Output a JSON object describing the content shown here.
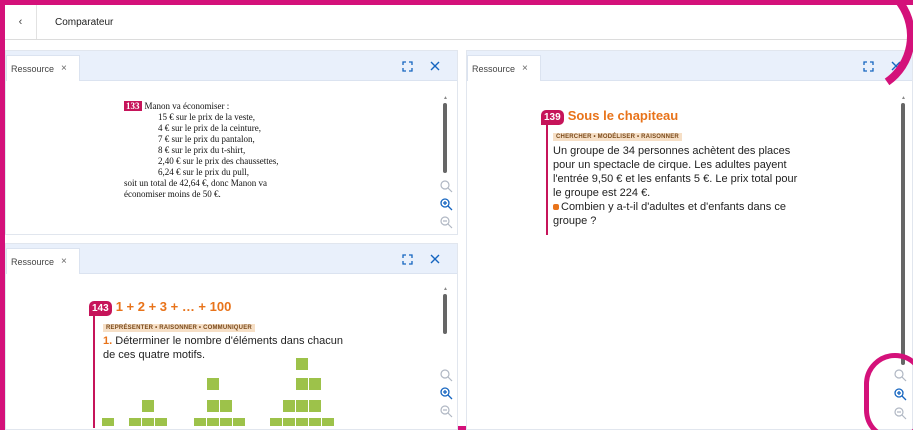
{
  "app": {
    "back_icon": "chevron-left-icon",
    "title": "Comparateur"
  },
  "panels": [
    {
      "tab_label": "Ressource",
      "close_tab_symbol": "×",
      "exercise": {
        "number": "133",
        "intro": "Manon va économiser :",
        "lines": [
          "15 € sur le prix de la veste,",
          "4 € sur le prix de la ceinture,",
          "7 € sur le prix du pantalon,",
          "8 € sur le prix du t-shirt,",
          "2,40 € sur le prix des chaussettes,",
          "6,24 € sur le prix du pull,"
        ],
        "conclusion_1": "soit un total de 42,64 €, donc Manon va",
        "conclusion_2": "économiser moins de 50 €."
      }
    },
    {
      "tab_label": "Ressource",
      "close_tab_symbol": "×",
      "exercise": {
        "number": "143",
        "title": "1 + 2 + 3 + … + 100",
        "skills": "REPRÉSENTER • RAISONNER • COMMUNIQUER",
        "q_num": "1.",
        "q_line_1": "Déterminer le nombre d'éléments dans chacun",
        "q_line_2": "de ces quatre motifs."
      }
    },
    {
      "tab_label": "Ressource",
      "close_tab_symbol": "×",
      "exercise": {
        "number": "139",
        "title": "Sous le chapiteau",
        "skills": "CHERCHER • MODÉLISER • RAISONNER",
        "body_lines": [
          "Un groupe de 34 personnes achètent des places",
          "pour un spectacle de cirque. Les adultes payent",
          "l'entrée 9,50 € et les enfants 5 €. Le prix total pour",
          "le groupe est 224 €."
        ],
        "question_1": "Combien y a-t-il d'adultes et d'enfants dans ce",
        "question_2": "groupe ?"
      }
    }
  ],
  "colors": {
    "highlight": "#d4117a",
    "header_blue": "#e9f0fb",
    "icon_blue": "#1565c0",
    "exercise_number": "#c6145a",
    "title_orange": "#e8731a",
    "skills_bg": "#f6dfc6",
    "squares_green": "#9dc24a"
  },
  "icons": {
    "expand": "expand-icon",
    "close": "close-icon",
    "zoom_reset": "zoom-reset-icon",
    "zoom_in": "zoom-in-icon",
    "zoom_out": "zoom-out-icon"
  }
}
